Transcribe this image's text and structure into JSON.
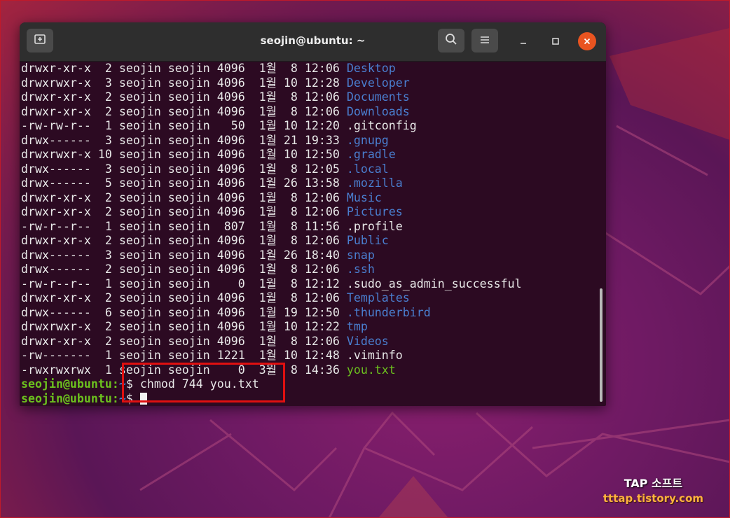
{
  "window": {
    "title": "seojin@ubuntu: ~",
    "new_tab_icon": "new-tab-icon",
    "search_icon": "search-icon",
    "menu_icon": "hamburger-menu-icon",
    "minimize_icon": "minimize-icon",
    "maximize_icon": "maximize-icon",
    "close_icon": "close-icon",
    "close_color": "#e95420"
  },
  "colors": {
    "directory": "#4a7fd0",
    "executable": "#6cc11e",
    "prompt": "#6cc11e",
    "text": "#e8e8e8",
    "highlight_box": "#e01010"
  },
  "listing": [
    {
      "info": "drwxr-xr-x  2 seojin seojin 4096  1월  8 12:06 ",
      "name": "Desktop",
      "type": "dir"
    },
    {
      "info": "drwxrwxr-x  3 seojin seojin 4096  1월 10 12:28 ",
      "name": "Developer",
      "type": "dir"
    },
    {
      "info": "drwxr-xr-x  2 seojin seojin 4096  1월  8 12:06 ",
      "name": "Documents",
      "type": "dir"
    },
    {
      "info": "drwxr-xr-x  2 seojin seojin 4096  1월  8 12:06 ",
      "name": "Downloads",
      "type": "dir"
    },
    {
      "info": "-rw-rw-r--  1 seojin seojin   50  1월 10 12:20 ",
      "name": ".gitconfig",
      "type": "file"
    },
    {
      "info": "drwx------  3 seojin seojin 4096  1월 21 19:33 ",
      "name": ".gnupg",
      "type": "dir"
    },
    {
      "info": "drwxrwxr-x 10 seojin seojin 4096  1월 10 12:50 ",
      "name": ".gradle",
      "type": "dir"
    },
    {
      "info": "drwx------  3 seojin seojin 4096  1월  8 12:05 ",
      "name": ".local",
      "type": "dir"
    },
    {
      "info": "drwx------  5 seojin seojin 4096  1월 26 13:58 ",
      "name": ".mozilla",
      "type": "dir"
    },
    {
      "info": "drwxr-xr-x  2 seojin seojin 4096  1월  8 12:06 ",
      "name": "Music",
      "type": "dir"
    },
    {
      "info": "drwxr-xr-x  2 seojin seojin 4096  1월  8 12:06 ",
      "name": "Pictures",
      "type": "dir"
    },
    {
      "info": "-rw-r--r--  1 seojin seojin  807  1월  8 11:56 ",
      "name": ".profile",
      "type": "file"
    },
    {
      "info": "drwxr-xr-x  2 seojin seojin 4096  1월  8 12:06 ",
      "name": "Public",
      "type": "dir"
    },
    {
      "info": "drwx------  3 seojin seojin 4096  1월 26 18:40 ",
      "name": "snap",
      "type": "dir"
    },
    {
      "info": "drwx------  2 seojin seojin 4096  1월  8 12:06 ",
      "name": ".ssh",
      "type": "dir"
    },
    {
      "info": "-rw-r--r--  1 seojin seojin    0  1월  8 12:12 ",
      "name": ".sudo_as_admin_successful",
      "type": "file"
    },
    {
      "info": "drwxr-xr-x  2 seojin seojin 4096  1월  8 12:06 ",
      "name": "Templates",
      "type": "dir"
    },
    {
      "info": "drwx------  6 seojin seojin 4096  1월 19 12:50 ",
      "name": ".thunderbird",
      "type": "dir"
    },
    {
      "info": "drwxrwxr-x  2 seojin seojin 4096  1월 10 12:22 ",
      "name": "tmp",
      "type": "dir"
    },
    {
      "info": "drwxr-xr-x  2 seojin seojin 4096  1월  8 12:06 ",
      "name": "Videos",
      "type": "dir"
    },
    {
      "info": "-rw-------  1 seojin seojin 1221  1월 10 12:48 ",
      "name": ".viminfo",
      "type": "file"
    },
    {
      "info": "-rwxrwxrwx  1 seojin seojin    0  3월  8 14:36 ",
      "name": "you.txt",
      "type": "exe"
    }
  ],
  "prompt_lines": [
    {
      "prompt": "seojin@ubuntu:",
      "path": "~",
      "symbol": "$ ",
      "command": "chmod 744 you.txt"
    },
    {
      "prompt": "seojin@ubuntu:",
      "path": "~",
      "symbol": "$ ",
      "command": ""
    }
  ],
  "watermark": {
    "line1": "TAP 소프트",
    "line2": "tttap.tistory.com"
  }
}
